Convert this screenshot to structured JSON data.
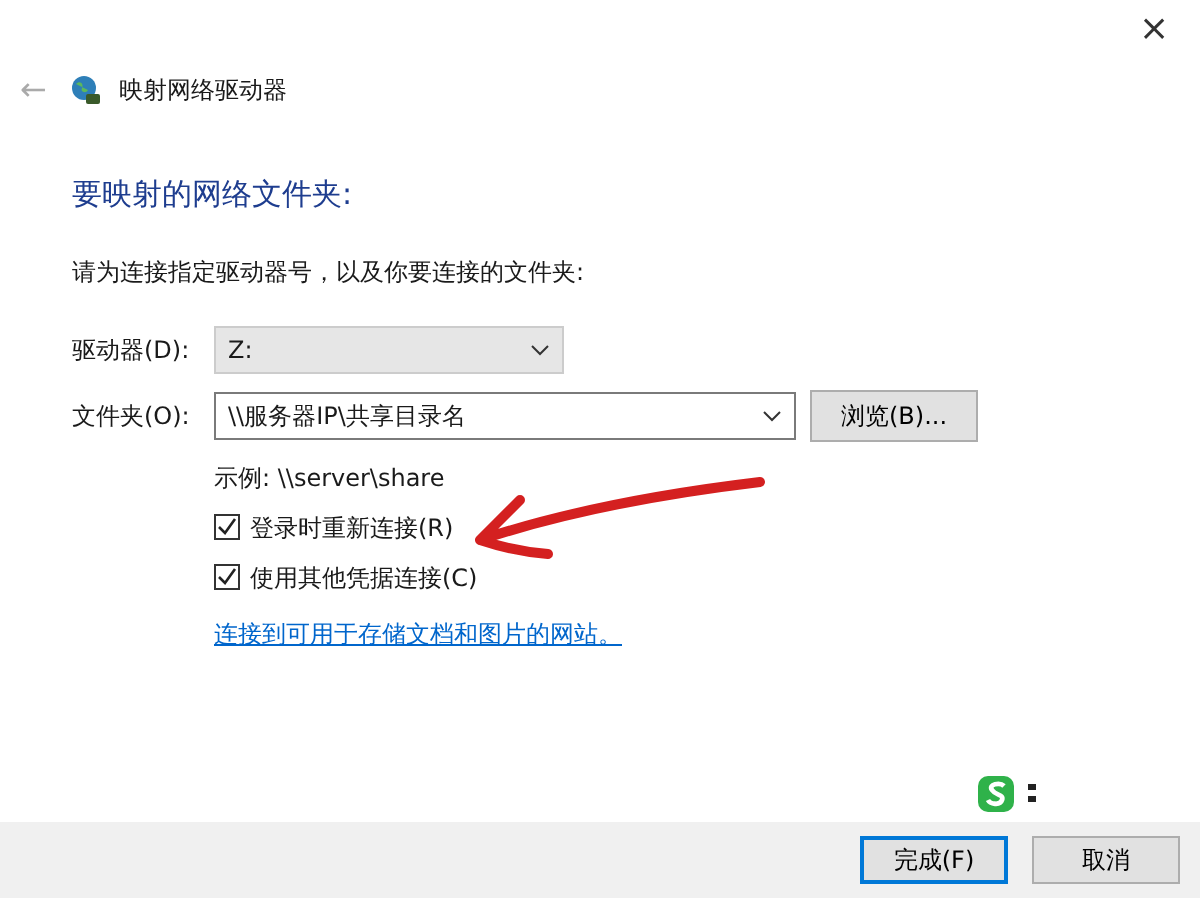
{
  "window": {
    "close": "×"
  },
  "header": {
    "back": "←",
    "title": "映射网络驱动器"
  },
  "heading": "要映射的网络文件夹:",
  "instruction": "请为连接指定驱动器号，以及你要连接的文件夹:",
  "drive": {
    "label": "驱动器(D):",
    "value": "Z:"
  },
  "folder": {
    "label": "文件夹(O):",
    "value": "\\\\服务器IP\\共享目录名",
    "browse": "浏览(B)..."
  },
  "example": "示例: \\\\server\\share",
  "options": [
    {
      "label": "登录时重新连接(R)",
      "checked": true
    },
    {
      "label": "使用其他凭据连接(C)",
      "checked": true
    }
  ],
  "link": "连接到可用于存储文档和图片的网站。",
  "buttons": [
    {
      "label": "完成(F)",
      "kind": "primary"
    },
    {
      "label": "取消",
      "kind": "secondary"
    }
  ]
}
